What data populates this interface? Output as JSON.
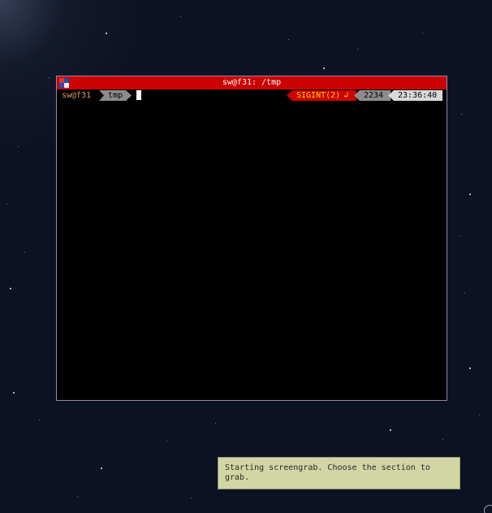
{
  "window": {
    "title": "sw@f31: /tmp",
    "titlebar_color": "#cc0000",
    "icon": "terminal-app-icon"
  },
  "prompt": {
    "user_host": "sw@f31",
    "directory": "tmp"
  },
  "status": {
    "signal": "SIGINT(2)",
    "return_glyph": "↲",
    "pid": "2234",
    "time": "23:36:40"
  },
  "notification": {
    "text": "Starting screengrab. Choose the section to grab."
  },
  "colors": {
    "desktop_bg": "#0c1222",
    "user_host": "#d4a052",
    "signal_bg": "#cc0000",
    "signal_fg": "#ffd800",
    "notification_bg": "#d2d6a4"
  }
}
